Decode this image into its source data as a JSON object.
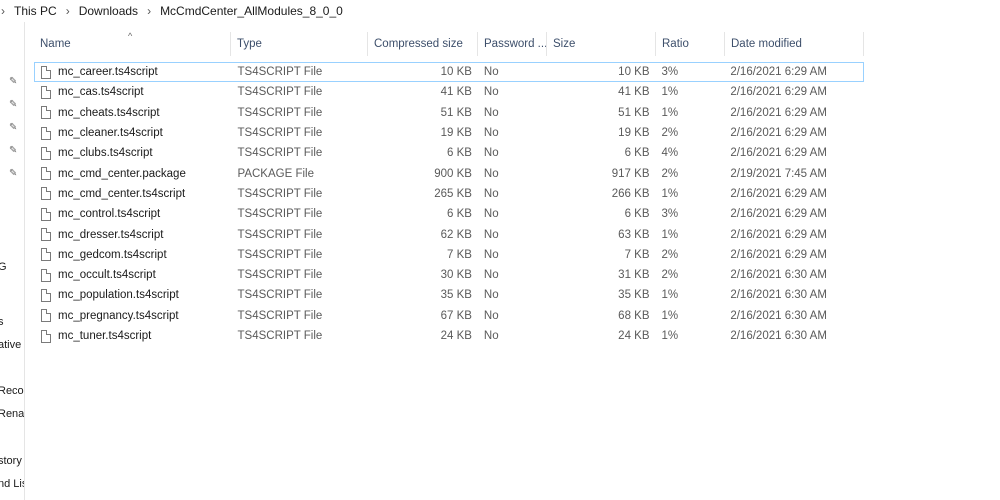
{
  "breadcrumb": {
    "items": [
      "This PC",
      "Downloads",
      "McCmdCenter_AllModules_8_0_0"
    ],
    "separator": "›"
  },
  "nav": {
    "labels": [
      "G",
      "s",
      "ative",
      "Recor",
      "Renai",
      "story",
      "nd Lis"
    ]
  },
  "columns": {
    "name": "Name",
    "type": "Type",
    "compressed": "Compressed size",
    "password": "Password ...",
    "size": "Size",
    "ratio": "Ratio",
    "date": "Date modified"
  },
  "files": [
    {
      "name": "mc_career.ts4script",
      "type": "TS4SCRIPT File",
      "compressed": "10 KB",
      "password": "No",
      "size": "10 KB",
      "ratio": "3%",
      "date": "2/16/2021 6:29 AM"
    },
    {
      "name": "mc_cas.ts4script",
      "type": "TS4SCRIPT File",
      "compressed": "41 KB",
      "password": "No",
      "size": "41 KB",
      "ratio": "1%",
      "date": "2/16/2021 6:29 AM"
    },
    {
      "name": "mc_cheats.ts4script",
      "type": "TS4SCRIPT File",
      "compressed": "51 KB",
      "password": "No",
      "size": "51 KB",
      "ratio": "1%",
      "date": "2/16/2021 6:29 AM"
    },
    {
      "name": "mc_cleaner.ts4script",
      "type": "TS4SCRIPT File",
      "compressed": "19 KB",
      "password": "No",
      "size": "19 KB",
      "ratio": "2%",
      "date": "2/16/2021 6:29 AM"
    },
    {
      "name": "mc_clubs.ts4script",
      "type": "TS4SCRIPT File",
      "compressed": "6 KB",
      "password": "No",
      "size": "6 KB",
      "ratio": "4%",
      "date": "2/16/2021 6:29 AM"
    },
    {
      "name": "mc_cmd_center.package",
      "type": "PACKAGE File",
      "compressed": "900 KB",
      "password": "No",
      "size": "917 KB",
      "ratio": "2%",
      "date": "2/19/2021 7:45 AM"
    },
    {
      "name": "mc_cmd_center.ts4script",
      "type": "TS4SCRIPT File",
      "compressed": "265 KB",
      "password": "No",
      "size": "266 KB",
      "ratio": "1%",
      "date": "2/16/2021 6:29 AM"
    },
    {
      "name": "mc_control.ts4script",
      "type": "TS4SCRIPT File",
      "compressed": "6 KB",
      "password": "No",
      "size": "6 KB",
      "ratio": "3%",
      "date": "2/16/2021 6:29 AM"
    },
    {
      "name": "mc_dresser.ts4script",
      "type": "TS4SCRIPT File",
      "compressed": "62 KB",
      "password": "No",
      "size": "63 KB",
      "ratio": "1%",
      "date": "2/16/2021 6:29 AM"
    },
    {
      "name": "mc_gedcom.ts4script",
      "type": "TS4SCRIPT File",
      "compressed": "7 KB",
      "password": "No",
      "size": "7 KB",
      "ratio": "2%",
      "date": "2/16/2021 6:29 AM"
    },
    {
      "name": "mc_occult.ts4script",
      "type": "TS4SCRIPT File",
      "compressed": "30 KB",
      "password": "No",
      "size": "31 KB",
      "ratio": "2%",
      "date": "2/16/2021 6:30 AM"
    },
    {
      "name": "mc_population.ts4script",
      "type": "TS4SCRIPT File",
      "compressed": "35 KB",
      "password": "No",
      "size": "35 KB",
      "ratio": "1%",
      "date": "2/16/2021 6:30 AM"
    },
    {
      "name": "mc_pregnancy.ts4script",
      "type": "TS4SCRIPT File",
      "compressed": "67 KB",
      "password": "No",
      "size": "68 KB",
      "ratio": "1%",
      "date": "2/16/2021 6:30 AM"
    },
    {
      "name": "mc_tuner.ts4script",
      "type": "TS4SCRIPT File",
      "compressed": "24 KB",
      "password": "No",
      "size": "24 KB",
      "ratio": "1%",
      "date": "2/16/2021 6:30 AM"
    }
  ],
  "icons": {
    "file": "file-icon",
    "pin": "pin-icon",
    "sort": "sort-up-icon"
  }
}
